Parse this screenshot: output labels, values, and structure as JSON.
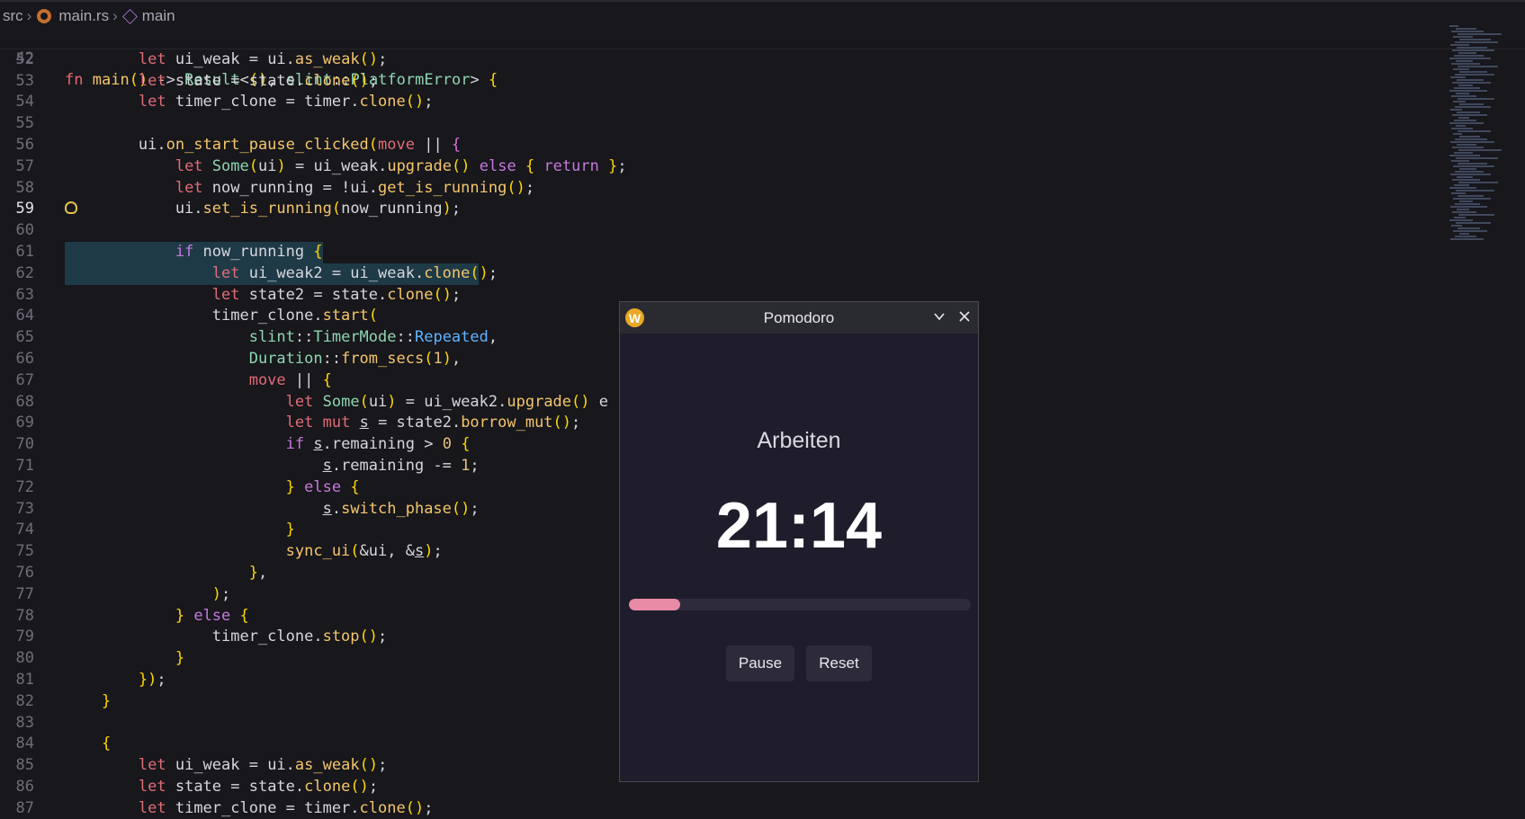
{
  "breadcrumb": {
    "folder": "src",
    "file": "main.rs",
    "symbol": "main"
  },
  "sticky": {
    "line_no": "42",
    "code": "fn main() -> Result<(), slint::PlatformError> {"
  },
  "lines": [
    {
      "n": "52",
      "t": "        let ui_weak = ui.as_weak();"
    },
    {
      "n": "53",
      "t": "        let state = state.clone();"
    },
    {
      "n": "54",
      "t": "        let timer_clone = timer.clone();"
    },
    {
      "n": "55",
      "t": ""
    },
    {
      "n": "56",
      "t": "        ui.on_start_pause_clicked(move || {"
    },
    {
      "n": "57",
      "t": "            let Some(ui) = ui_weak.upgrade() else { return };"
    },
    {
      "n": "58",
      "t": "            let now_running = !ui.get_is_running();"
    },
    {
      "n": "59",
      "t": "            ui.set_is_running(now_running);"
    },
    {
      "n": "60",
      "t": ""
    },
    {
      "n": "61",
      "t": "            if now_running {"
    },
    {
      "n": "62",
      "t": "                let ui_weak2 = ui_weak.clone();"
    },
    {
      "n": "63",
      "t": "                let state2 = state.clone();"
    },
    {
      "n": "64",
      "t": "                timer_clone.start("
    },
    {
      "n": "65",
      "t": "                    slint::TimerMode::Repeated,"
    },
    {
      "n": "66",
      "t": "                    Duration::from_secs(1),"
    },
    {
      "n": "67",
      "t": "                    move || {"
    },
    {
      "n": "68",
      "t": "                        let Some(ui) = ui_weak2.upgrade() e"
    },
    {
      "n": "69",
      "t": "                        let mut s = state2.borrow_mut();"
    },
    {
      "n": "70",
      "t": "                        if s.remaining > 0 {"
    },
    {
      "n": "71",
      "t": "                            s.remaining -= 1;"
    },
    {
      "n": "72",
      "t": "                        } else {"
    },
    {
      "n": "73",
      "t": "                            s.switch_phase();"
    },
    {
      "n": "74",
      "t": "                        }"
    },
    {
      "n": "75",
      "t": "                        sync_ui(&ui, &s);"
    },
    {
      "n": "76",
      "t": "                    },"
    },
    {
      "n": "77",
      "t": "                );"
    },
    {
      "n": "78",
      "t": "            } else {"
    },
    {
      "n": "79",
      "t": "                timer_clone.stop();"
    },
    {
      "n": "80",
      "t": "            }"
    },
    {
      "n": "81",
      "t": "        });"
    },
    {
      "n": "82",
      "t": "    }"
    },
    {
      "n": "83",
      "t": ""
    },
    {
      "n": "84",
      "t": "    {"
    },
    {
      "n": "85",
      "t": "        let ui_weak = ui.as_weak();"
    },
    {
      "n": "86",
      "t": "        let state = state.clone();"
    },
    {
      "n": "87",
      "t": "        let timer_clone = timer.clone();"
    }
  ],
  "pomodoro": {
    "title": "Pomodoro",
    "icon_letter": "W",
    "phase": "Arbeiten",
    "time": "21:14",
    "progress_fraction": 0.15,
    "pause_label": "Pause",
    "reset_label": "Reset",
    "colors": {
      "progress": "#e98aa6",
      "background": "#1f1d2c",
      "icon": "#e9a825"
    }
  }
}
